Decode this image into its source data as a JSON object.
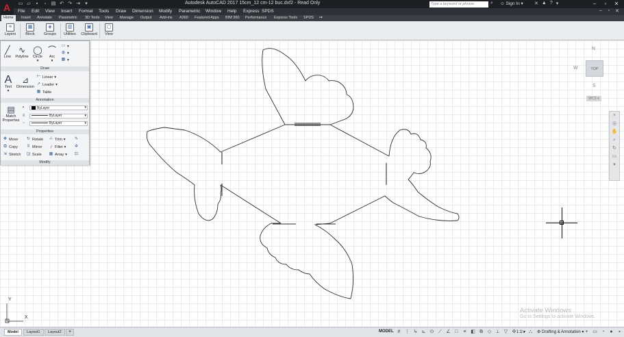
{
  "titlebar": {
    "app_logo": "A",
    "title": "Autodesk AutoCAD 2017    15cm_12 cm-12 buc.dxf2 - Read Only",
    "search_placeholder": "Type a keyword or phrase",
    "signin": "Sign In"
  },
  "menubar": [
    "File",
    "Edit",
    "View",
    "Insert",
    "Format",
    "Tools",
    "Draw",
    "Dimension",
    "Modify",
    "Parametric",
    "Window",
    "Help",
    "Express",
    "SPDS"
  ],
  "ribbon_tabs": [
    "Home",
    "Insert",
    "Annotate",
    "Parametric",
    "3D Tools",
    "View",
    "Manage",
    "Output",
    "Add-ins",
    "A360",
    "Featured Apps",
    "BIM 360",
    "Performance",
    "Express Tools",
    "SPDS"
  ],
  "ribbon": {
    "buttons": [
      "Layers",
      "Block",
      "Groups",
      "Utilities",
      "Clipboard",
      "View"
    ]
  },
  "panel": {
    "draw_tools": [
      "Line",
      "Polyline",
      "Circle",
      "Arc"
    ],
    "draw_title": "Draw",
    "text_label": "Text",
    "dimension_label": "Dimension",
    "annot_items": [
      "Linear",
      "Leader",
      "Table"
    ],
    "annotation_title": "Annotation",
    "match_label": "Match Properties",
    "bylayer": "ByLayer",
    "properties_title": "Properties",
    "modify_items": [
      "Move",
      "Rotate",
      "Trim",
      "Copy",
      "Mirror",
      "Fillet",
      "Stretch",
      "Scale",
      "Array"
    ],
    "modify_title": "Modify"
  },
  "viewcube": {
    "n": "N",
    "w": "W",
    "s": "S",
    "top": "TOP",
    "wcs": "WCS"
  },
  "ucs": {
    "y": "Y",
    "x": "X"
  },
  "watermark": {
    "line1": "Activate Windows",
    "line2": "Go to Settings to activate Windows."
  },
  "statusbar": {
    "layout_tabs": [
      "Model",
      "Layout1",
      "Layout2"
    ],
    "add_tab": "+",
    "model": "MODEL",
    "scale": "1:1",
    "workspace": "Drafting & Annotation"
  }
}
